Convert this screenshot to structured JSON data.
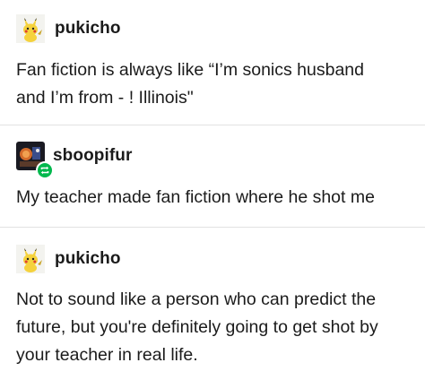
{
  "posts": [
    {
      "username": "pukicho",
      "avatar": "pikachu-plush-avatar",
      "text_lines": [
        "Fan fiction is always like “I’m sonics husband",
        "and I’m from  - ! Illinois\""
      ]
    },
    {
      "username": "sboopifur",
      "avatar": "dark-photo-avatar",
      "badge": "reblog-icon",
      "text_lines": [
        "My teacher made fan fiction where he shot me"
      ]
    },
    {
      "username": "pukicho",
      "avatar": "pikachu-plush-avatar",
      "text_lines": [
        "Not to sound like a person who can predict the",
        "future, but you're definitely going to get shot by",
        "your teacher in real life."
      ]
    }
  ],
  "colors": {
    "text": "#1b1b1b",
    "divider": "#e2e2e2",
    "reblog_badge": "#00b84d",
    "pikachu_yellow": "#f5d23c"
  }
}
